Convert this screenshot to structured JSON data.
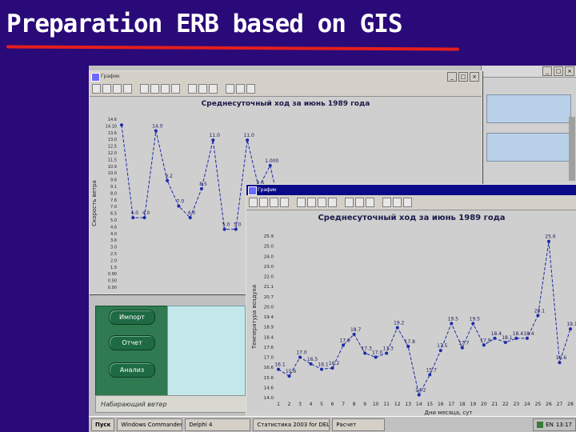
{
  "slide": {
    "title": "Preparation ERB based on GIS"
  },
  "sidebar": {
    "buttons": [
      {
        "label": "Импорт"
      },
      {
        "label": "Отчет"
      },
      {
        "label": "Анализ"
      }
    ],
    "status_text": "Набирающий ветер"
  },
  "window1": {
    "title": "График",
    "chart_title": "Среднесуточный ход за  июнь  1989  года",
    "ylabel": "Скорость ветра",
    "chart_data": {
      "type": "line",
      "x": [
        1,
        2,
        3,
        4,
        5,
        6,
        7,
        8,
        9,
        10,
        11,
        12,
        13,
        14,
        15
      ],
      "y": [
        14.0,
        6.0,
        6.0,
        13.5,
        9.2,
        7.0,
        6.0,
        8.5,
        12.7,
        5.0,
        5.0,
        12.7,
        8.6,
        10.5,
        6.2
      ],
      "ylim": [
        0,
        14.5
      ],
      "point_labels": [
        "",
        "4.0",
        "4.0",
        "14.0",
        "9.2",
        "7.0",
        "6.0",
        "8.5",
        "11.0",
        "5.0",
        "5.0",
        "11.0",
        "8.6",
        "1.000",
        ""
      ]
    },
    "yticks": [
      "14.6",
      "14.10",
      "13.6",
      "13.0",
      "12.5",
      "12.0",
      "11.5",
      "10.9",
      "10.0",
      "9.6",
      "9.1",
      "8.0",
      "7.6",
      "7.0",
      "6.5",
      "5.0",
      "4.6",
      "4.0",
      "3.6",
      "3.0",
      "2.5",
      "2.0",
      "1.5",
      "0.90",
      "0.50",
      "0.00"
    ]
  },
  "window2": {
    "title": "График",
    "chart_title": "Среднесуточный ход за  июнь  1989  года",
    "ylabel": "Температура воздуха",
    "xlabel": "Дни месяца, сут",
    "chart_data": {
      "type": "line",
      "x": [
        1,
        2,
        3,
        4,
        5,
        6,
        7,
        8,
        9,
        10,
        11,
        12,
        13,
        14,
        15,
        16,
        17,
        18,
        19,
        20,
        21,
        22,
        23,
        24,
        25,
        26,
        27,
        28
      ],
      "y": [
        16.1,
        15.6,
        17.0,
        16.5,
        16.1,
        16.2,
        17.9,
        18.7,
        17.3,
        17.0,
        17.3,
        19.2,
        17.8,
        14.2,
        15.7,
        17.5,
        19.5,
        17.7,
        19.5,
        17.9,
        18.4,
        18.1,
        18.4,
        18.4,
        20.1,
        25.6,
        16.6,
        19.1
      ],
      "point_labels": [
        "16.1",
        "15.6",
        "17.0",
        "16.5",
        "16.1",
        "16.2",
        "17.9",
        "18.7",
        "17.3",
        "17.0",
        "17.3",
        "19.2",
        "17.8",
        "14.2",
        "15.7",
        "17.5",
        "19.5",
        "17.7",
        "19.5",
        "17.9",
        "18.4",
        "18.1",
        "18.4",
        "18.4",
        "20.1",
        "25.6",
        "16.6",
        "19.1"
      ],
      "ylim": [
        14.0,
        26.0
      ]
    },
    "yticks": [
      "25.9",
      "25.0",
      "24.0",
      "23.0",
      "22.0",
      "21.1",
      "20.7",
      "20.0",
      "19.4",
      "18.9",
      "18.4",
      "17.6",
      "17.0",
      "16.6",
      "15.6",
      "14.6",
      "14.0"
    ],
    "xticks": [
      "1",
      "2",
      "3",
      "4",
      "5",
      "6",
      "7",
      "8",
      "9",
      "10",
      "11",
      "12",
      "13",
      "14",
      "15",
      "16",
      "17",
      "18",
      "19",
      "20",
      "21",
      "22",
      "23",
      "24",
      "25",
      "26",
      "27",
      "28"
    ]
  },
  "taskbar": {
    "start_label": "Пуск",
    "items": [
      "Windows Commander 3.52",
      "Delphi 4",
      "Статистика 2003 for DEL",
      "Расчет"
    ],
    "tray_text": "EN",
    "clock": "13:17"
  },
  "colors": {
    "slide_bg": "#2a0a78",
    "underline": "#e41e1e",
    "series": "#1e2aa8",
    "window_title_active": "#0a0a88"
  }
}
